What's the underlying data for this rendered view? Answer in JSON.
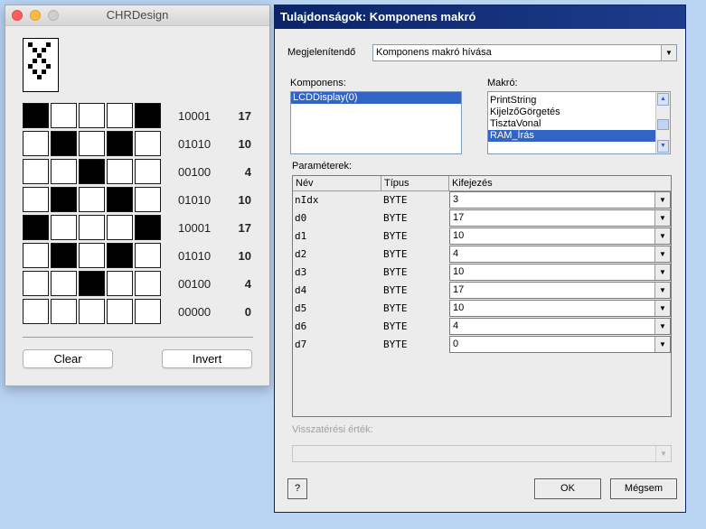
{
  "chr": {
    "title": "CHRDesign",
    "rows": [
      {
        "bits": [
          1,
          0,
          0,
          0,
          1
        ],
        "binary": "10001",
        "decimal": "17"
      },
      {
        "bits": [
          0,
          1,
          0,
          1,
          0
        ],
        "binary": "01010",
        "decimal": "10"
      },
      {
        "bits": [
          0,
          0,
          1,
          0,
          0
        ],
        "binary": "00100",
        "decimal": "4"
      },
      {
        "bits": [
          0,
          1,
          0,
          1,
          0
        ],
        "binary": "01010",
        "decimal": "10"
      },
      {
        "bits": [
          1,
          0,
          0,
          0,
          1
        ],
        "binary": "10001",
        "decimal": "17"
      },
      {
        "bits": [
          0,
          1,
          0,
          1,
          0
        ],
        "binary": "01010",
        "decimal": "10"
      },
      {
        "bits": [
          0,
          0,
          1,
          0,
          0
        ],
        "binary": "00100",
        "decimal": "4"
      },
      {
        "bits": [
          0,
          0,
          0,
          0,
          0
        ],
        "binary": "00000",
        "decimal": "0"
      }
    ],
    "clear_label": "Clear",
    "invert_label": "Invert"
  },
  "dialog": {
    "title": "Tulajdonságok: Komponens makró",
    "display_label": "Megjelenítendő",
    "display_value": "Komponens makró hívása",
    "component_label": "Komponens:",
    "components": [
      "LCDDisplay(0)"
    ],
    "macro_label": "Makró:",
    "macros": [
      "PrintString",
      "KijelzőGörgetés",
      "TisztaVonal",
      "RAM_Írás"
    ],
    "params_label": "Paraméterek:",
    "columns": {
      "name": "Név",
      "type": "Típus",
      "expr": "Kifejezés"
    },
    "params": [
      {
        "name": "nIdx",
        "type": "BYTE",
        "expr": "3"
      },
      {
        "name": "d0",
        "type": "BYTE",
        "expr": "17"
      },
      {
        "name": "d1",
        "type": "BYTE",
        "expr": "10"
      },
      {
        "name": "d2",
        "type": "BYTE",
        "expr": "4"
      },
      {
        "name": "d3",
        "type": "BYTE",
        "expr": "10"
      },
      {
        "name": "d4",
        "type": "BYTE",
        "expr": "17"
      },
      {
        "name": "d5",
        "type": "BYTE",
        "expr": "10"
      },
      {
        "name": "d6",
        "type": "BYTE",
        "expr": "4"
      },
      {
        "name": "d7",
        "type": "BYTE",
        "expr": "0"
      }
    ],
    "return_label": "Visszatérési érték:",
    "return_value": "",
    "help_label": "?",
    "ok_label": "OK",
    "cancel_label": "Mégsem"
  }
}
